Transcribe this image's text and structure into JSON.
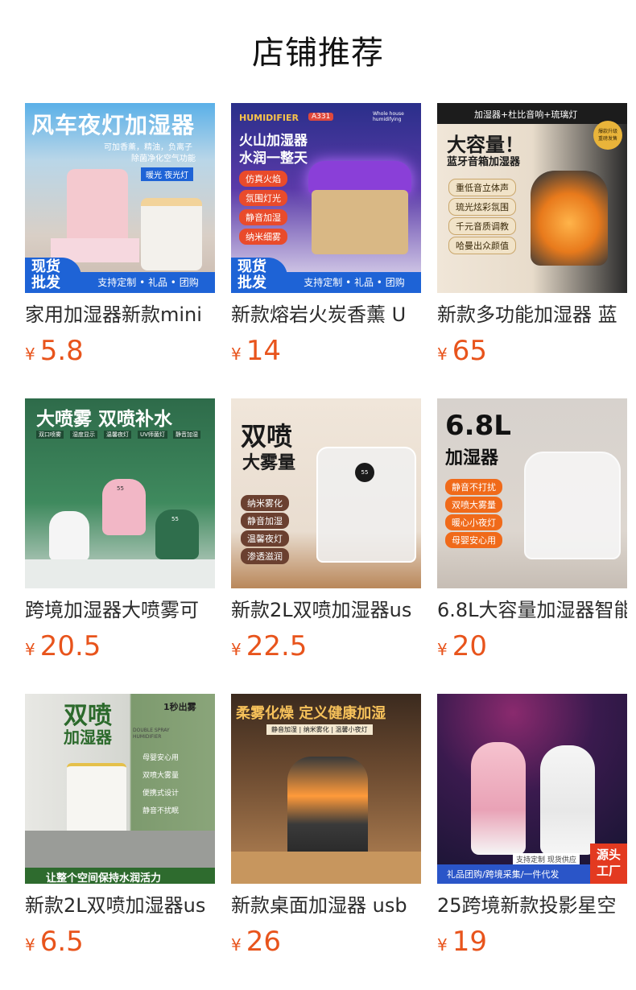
{
  "page": {
    "title": "店铺推荐"
  },
  "currency_symbol": "¥",
  "products": [
    {
      "name": "家用加湿器新款mini",
      "price": "5.8",
      "image_text": {
        "headline": "风车夜灯加湿器",
        "sub1": "可加香薰，精油，负离子",
        "sub2": "除菌净化空气功能",
        "tag": "暖光 夜光灯",
        "stock1": "现货",
        "stock2": "批发",
        "banner": "支持定制 • 礼品 • 团购"
      }
    },
    {
      "name": "新款熔岩火炭香薰 U",
      "price": "14",
      "image_text": {
        "brand": "HUMIDIFIER",
        "model": "A331",
        "corner": "Whole house humidifying",
        "line1": "火山加湿器",
        "line2": "水润一整天",
        "features": [
          "仿真火焰",
          "氛围灯光",
          "静音加湿",
          "纳米细雾"
        ],
        "stock1": "现货",
        "stock2": "批发",
        "banner": "支持定制 • 礼品 • 团购"
      }
    },
    {
      "name": "新款多功能加湿器 蓝",
      "price": "65",
      "image_text": {
        "top": "加湿器+杜比音响+琉璃灯",
        "headline": "大容量！",
        "sub": "蓝牙音箱加湿器",
        "seal1": "爆款升级",
        "seal2": "重磅发售",
        "features": [
          "重低音立体声",
          "琉光炫彩氛围",
          "千元音质调教",
          "哈曼出众颜值"
        ]
      }
    },
    {
      "name": "跨境加湿器大喷雾可",
      "price": "20.5",
      "image_text": {
        "headline": "大喷雾 双喷补水",
        "features": [
          "双口喷雾",
          "湿度显示",
          "温馨夜灯",
          "UV师菌灯",
          "静音加湿"
        ],
        "display1": "55",
        "display2": "55"
      }
    },
    {
      "name": "新款2L双喷加湿器us",
      "price": "22.5",
      "image_text": {
        "headline1": "双喷",
        "headline2": "大雾量",
        "display": "55",
        "features": [
          "纳米雾化",
          "静音加湿",
          "温馨夜灯",
          "渗透滋润"
        ]
      }
    },
    {
      "name": "6.8L大容量加湿器智能",
      "price": "20",
      "image_text": {
        "headline1": "6.8L",
        "headline2": "加湿器",
        "features": [
          "静音不打扰",
          "双喷大雾量",
          "暖心小夜灯",
          "母婴安心用"
        ]
      }
    },
    {
      "name": "新款2L双喷加湿器us",
      "price": "6.5",
      "image_text": {
        "headline1": "双喷",
        "headline2": "加湿器",
        "corner": "1秒出雾",
        "eng1": "DOUBLE SPRAY",
        "eng2": "HUMIDIFIER",
        "features": [
          "母婴安心用",
          "双喷大雾量",
          "便携式设计",
          "静音不扰眠"
        ],
        "bottom": "让整个空间保持水润活力"
      }
    },
    {
      "name": "新款桌面加湿器 usb",
      "price": "26",
      "image_text": {
        "headline": "柔雾化燥 定义健康加湿",
        "sub": "静音加湿 | 纳米雾化 | 温馨小夜灯"
      }
    },
    {
      "name": "25跨境新款投影星空",
      "price": "19",
      "image_text": {
        "tag": "支持定制 现货供应",
        "bottom": "礼品团购/跨境采集/一件代发",
        "corner1": "源头",
        "corner2": "工厂"
      }
    }
  ]
}
